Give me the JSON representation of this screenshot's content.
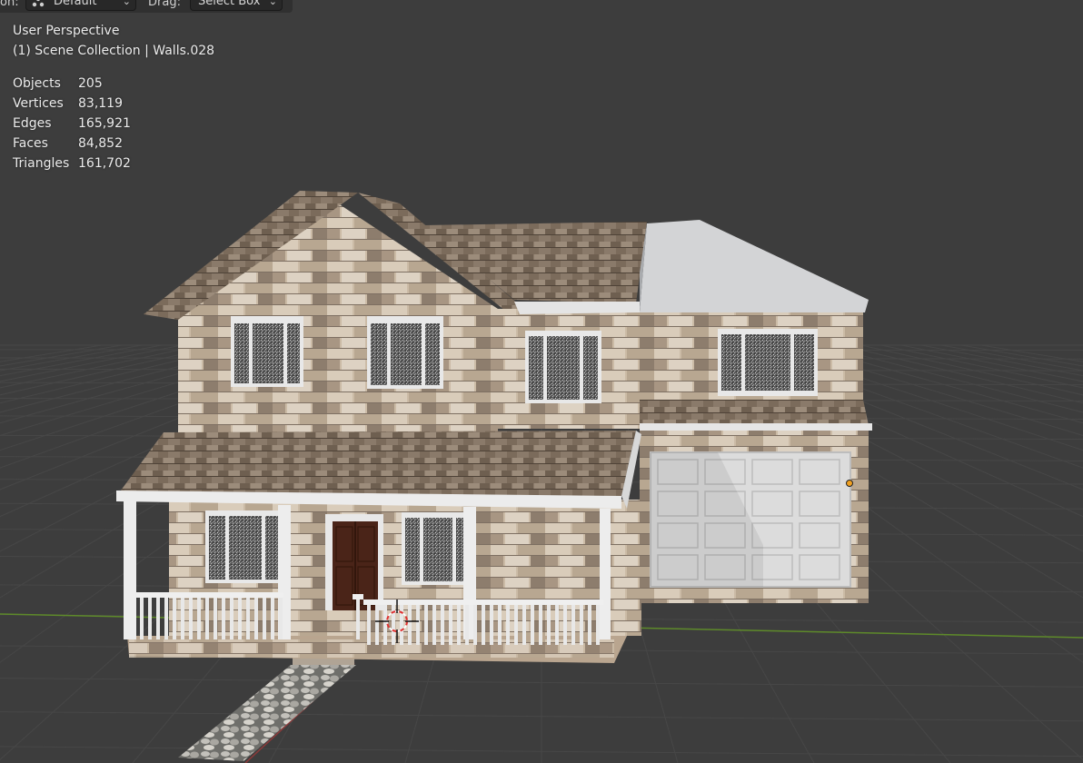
{
  "header": {
    "orientation_label_partial": "on:",
    "orientation_value": "Default",
    "drag_label": "Drag:",
    "drag_value": "Select Box"
  },
  "overlay": {
    "view_name": "User Perspective",
    "collection_info": "(1) Scene Collection | Walls.028"
  },
  "stats": [
    {
      "label": "Objects",
      "value": "205"
    },
    {
      "label": "Vertices",
      "value": "83,119"
    },
    {
      "label": "Edges",
      "value": "165,921"
    },
    {
      "label": "Faces",
      "value": "84,852"
    },
    {
      "label": "Triangles",
      "value": "161,702"
    }
  ],
  "colors": {
    "viewport_bg": "#3d3d3d",
    "grid_line": "#464646",
    "axis_x": "#8c3a3a",
    "axis_y": "#5e8a2a",
    "stone": "#c8b8a4",
    "stone_dark": "#8f8172",
    "roof": "#7a6a5a",
    "trim": "#e8e8e8",
    "door": "#4a2418",
    "cursor": "#e03030"
  },
  "icons": {
    "orientation_icon": "transform-orientation-icon",
    "dropdown": "chevron-down-icon",
    "cursor_3d": "3d-cursor-icon",
    "origin": "object-origin-icon"
  }
}
